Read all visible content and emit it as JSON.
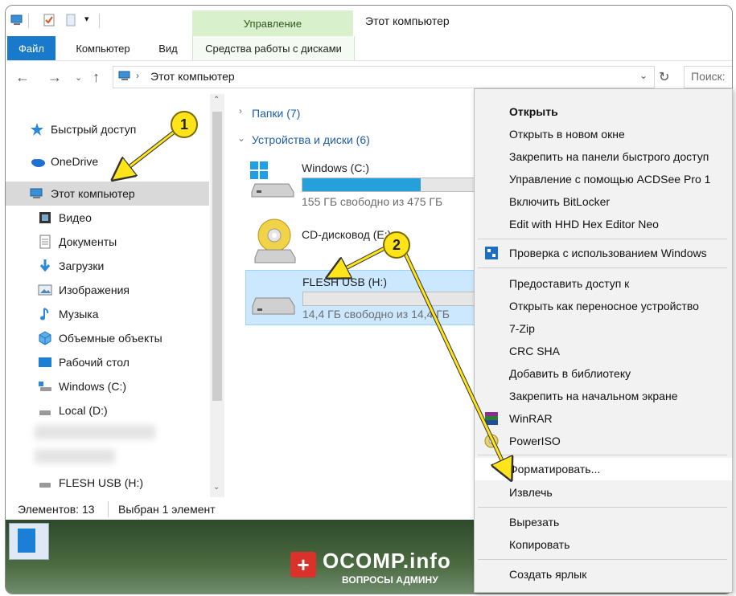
{
  "window": {
    "title": "Этот компьютер",
    "manage_group_label": "Управление"
  },
  "ribbon": {
    "tabs": [
      {
        "label": "Файл"
      },
      {
        "label": "Компьютер"
      },
      {
        "label": "Вид"
      },
      {
        "label": "Средства работы с дисками"
      }
    ]
  },
  "address": {
    "path": "Этот компьютер",
    "search_placeholder": "Поиск:"
  },
  "sidebar": {
    "items": [
      {
        "label": "Быстрый доступ",
        "icon": "star-icon"
      },
      {
        "label": "OneDrive",
        "icon": "cloud-icon"
      },
      {
        "label": "Этот компьютер",
        "icon": "computer-icon",
        "selected": true
      },
      {
        "label": "Видео",
        "icon": "film-icon"
      },
      {
        "label": "Документы",
        "icon": "document-icon"
      },
      {
        "label": "Загрузки",
        "icon": "download-icon"
      },
      {
        "label": "Изображения",
        "icon": "image-icon"
      },
      {
        "label": "Музыка",
        "icon": "music-icon"
      },
      {
        "label": "Объемные объекты",
        "icon": "cube-icon"
      },
      {
        "label": "Рабочий стол",
        "icon": "desktop-icon"
      },
      {
        "label": "Windows (C:)",
        "icon": "drive-icon"
      },
      {
        "label": "Local (D:)",
        "icon": "drive-icon"
      },
      {
        "label": "FLESH USB (H:)",
        "icon": "usb-drive-icon"
      }
    ]
  },
  "content": {
    "groups": [
      {
        "label": "Папки (7)"
      },
      {
        "label": "Устройства и диски (6)"
      }
    ],
    "drives": [
      {
        "name": "Windows (C:)",
        "free": "155 ГБ свободно из 475 ГБ",
        "used_fraction": 0.67
      },
      {
        "name": "CD-дисковод (E:)"
      },
      {
        "name": "FLESH USB (H:)",
        "free": "14,4 ГБ свободно из 14,4 ГБ",
        "used_fraction": 0.0
      }
    ]
  },
  "status": {
    "count": "Элементов: 13",
    "selected": "Выбран 1 элемент"
  },
  "context_menu": {
    "items": [
      {
        "label": "Открыть",
        "bold": true
      },
      {
        "label": "Открыть в новом окне"
      },
      {
        "label": "Закрепить на панели быстрого доступ"
      },
      {
        "label": "Управление с помощью ACDSee Pro 1"
      },
      {
        "label": "Включить BitLocker"
      },
      {
        "label": "Edit with HHD Hex Editor Neo"
      },
      {
        "label": "Проверка с использованием Windows"
      },
      {
        "label": "Предоставить доступ к"
      },
      {
        "label": "Открыть как переносное устройство"
      },
      {
        "label": "7-Zip"
      },
      {
        "label": "CRC SHA"
      },
      {
        "label": "Добавить в библиотеку"
      },
      {
        "label": "Закрепить на начальном экране"
      },
      {
        "label": "WinRAR"
      },
      {
        "label": "PowerISO"
      },
      {
        "label": "Форматировать..."
      },
      {
        "label": "Извлечь"
      },
      {
        "label": "Вырезать"
      },
      {
        "label": "Копировать"
      },
      {
        "label": "Создать ярлык"
      }
    ]
  },
  "annotations": {
    "badge1": "1",
    "badge2": "2",
    "arrow_color": "#ffe41a"
  },
  "watermark": {
    "brand": "OCOMP.info",
    "tagline": "ВОПРОСЫ АДМИНУ"
  },
  "colors": {
    "accent": "#1979ca",
    "selection": "#cce8ff",
    "manage_tab": "#d9f0cc",
    "progress": "#26a0da"
  }
}
